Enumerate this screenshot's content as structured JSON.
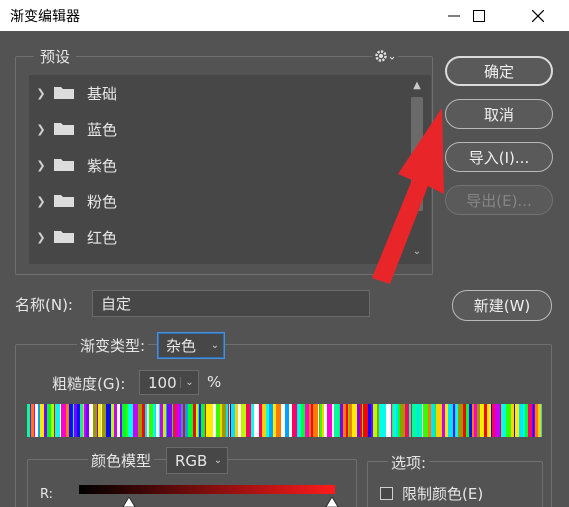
{
  "window": {
    "title": "渐变编辑器"
  },
  "presets": {
    "legend": "预设",
    "items": [
      {
        "label": "基础"
      },
      {
        "label": "蓝色"
      },
      {
        "label": "紫色"
      },
      {
        "label": "粉色"
      },
      {
        "label": "红色"
      }
    ]
  },
  "buttons": {
    "ok": "确定",
    "cancel": "取消",
    "import": "导入(I)...",
    "export": "导出(E)...",
    "new": "新建(W)"
  },
  "name_field": {
    "label": "名称(N):",
    "value": "自定"
  },
  "gradient": {
    "type_label": "渐变类型:",
    "type_value": "杂色",
    "roughness_label": "粗糙度(G):",
    "roughness_value": "100",
    "roughness_unit": "%"
  },
  "color_model": {
    "label": "颜色模型",
    "value": "RGB",
    "channel_r": "R:"
  },
  "options": {
    "legend": "选项:",
    "restrict_colors": "限制颜色(E)",
    "restrict_colors_checked": false
  },
  "colors": {
    "accent_arrow": "#e8262a",
    "panel_bg": "#535353",
    "focus_blue": "#4a90d9"
  }
}
